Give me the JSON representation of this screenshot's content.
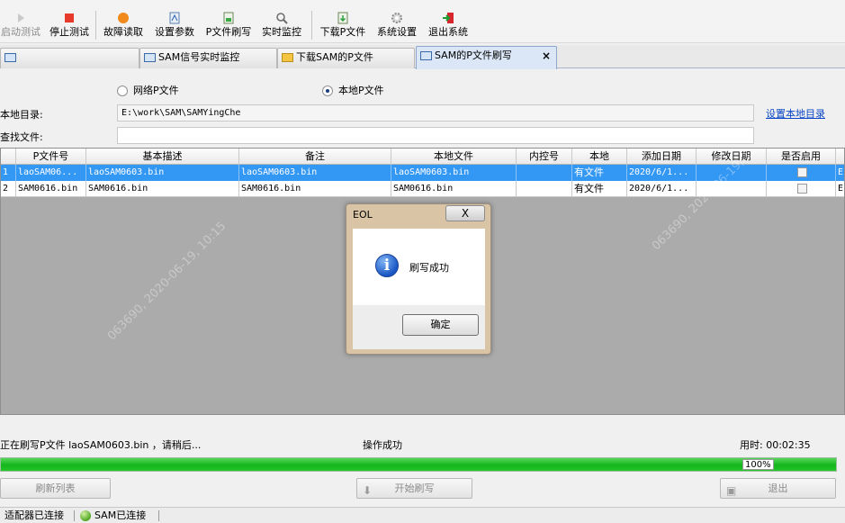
{
  "toolbar": {
    "buttons": [
      {
        "label": "启动测试",
        "icon": "play-icon",
        "enabled": false
      },
      {
        "label": "停止测试",
        "icon": "stop-icon",
        "enabled": true
      },
      {
        "label": "故障读取",
        "icon": "fault-read-icon",
        "enabled": true
      },
      {
        "label": "设置参数",
        "icon": "settings-params-icon",
        "enabled": true
      },
      {
        "label": "P文件刷写",
        "icon": "file-flash-icon",
        "enabled": true
      },
      {
        "label": "实时监控",
        "icon": "monitor-icon",
        "enabled": true
      },
      {
        "label": "下载P文件",
        "icon": "download-file-icon",
        "enabled": true
      },
      {
        "label": "系统设置",
        "icon": "gear-icon",
        "enabled": true
      },
      {
        "label": "退出系统",
        "icon": "exit-icon",
        "enabled": true
      }
    ]
  },
  "tabs": [
    {
      "label": ""
    },
    {
      "label": "SAM信号实时监控"
    },
    {
      "label": "下载SAM的P文件"
    },
    {
      "label": "SAM的P文件刷写",
      "active": true,
      "close": "×"
    }
  ],
  "form": {
    "radio_network": "网络P文件",
    "radio_local": "本地P文件",
    "local_dir_label": "本地目录:",
    "local_dir_value": "E:\\work\\SAM\\SAMYingChe",
    "find_file_label": "查找文件:",
    "find_file_value": "",
    "set_local_dir_link": "设置本地目录"
  },
  "grid": {
    "columns": [
      "P文件号",
      "基本描述",
      "备注",
      "本地文件",
      "内控号",
      "本地",
      "添加日期",
      "修改日期",
      "是否启用"
    ],
    "rows": [
      {
        "index": "1",
        "p_file": "laoSAM06...",
        "desc": "laoSAM0603.bin",
        "note": "laoSAM0603.bin",
        "local_file": "laoSAM0603.bin",
        "control_no": "",
        "local": "有文件",
        "added": "2020/6/1...",
        "modified": "",
        "enabled": false,
        "extra": "E"
      },
      {
        "index": "2",
        "p_file": "SAM0616.bin",
        "desc": "SAM0616.bin",
        "note": "SAM0616.bin",
        "local_file": "SAM0616.bin",
        "control_no": "",
        "local": "有文件",
        "added": "2020/6/1...",
        "modified": "",
        "enabled": false,
        "extra": "E"
      }
    ],
    "watermark": "063690, 2020-06-19, 10:15"
  },
  "dialog": {
    "title": "EOL",
    "close": "X",
    "message": "刷写成功",
    "ok_label": "确定",
    "icon": "info-icon"
  },
  "status": {
    "progress_text": "正在刷写P文件 laoSAM0603.bin ，请稍后...",
    "result_text": "操作成功",
    "elapsed": "用时: 00:02:35",
    "progress_value": 1.0,
    "progress_label": "100%"
  },
  "actions": {
    "refresh": "刷新列表",
    "start_flash": "开始刷写",
    "exit": "退出"
  },
  "statusbar": {
    "adapter": "适配器已连接",
    "sam": "SAM已连接"
  },
  "colors": {
    "selection": "#3397f4",
    "progress": "#14b61c",
    "link": "#0b47c6"
  }
}
